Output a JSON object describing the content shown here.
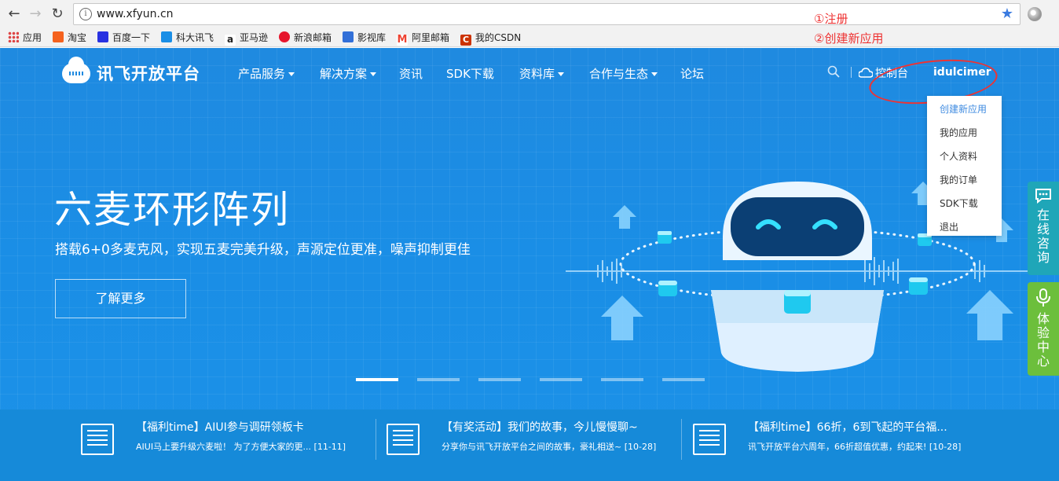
{
  "browser": {
    "url": "www.xfyun.cn",
    "bookmarks": [
      {
        "label": "应用",
        "icon": "apps-grid-icon"
      },
      {
        "label": "淘宝",
        "icon": "taobao-icon",
        "color": "#f5621e"
      },
      {
        "label": "百度一下",
        "icon": "baidu-icon",
        "color": "#2932e1"
      },
      {
        "label": "科大讯飞",
        "icon": "iflytek-icon",
        "color": "#1a8ee6"
      },
      {
        "label": "亚马逊",
        "icon": "amazon-icon",
        "color": "#222222"
      },
      {
        "label": "新浪邮箱",
        "icon": "sina-icon",
        "color": "#e6162d"
      },
      {
        "label": "影视库",
        "icon": "video-icon",
        "color": "#3370d8"
      },
      {
        "label": "阿里邮箱",
        "icon": "ali-mail-icon",
        "color": "#e43"
      },
      {
        "label": "我的CSDN",
        "icon": "csdn-icon",
        "color": "#c30"
      }
    ]
  },
  "annotations": {
    "step1": "①注册",
    "step2": "②创建新应用",
    "color": "#e33"
  },
  "site": {
    "logo_text": "讯飞开放平台",
    "nav": [
      {
        "label": "产品服务",
        "dropdown": true
      },
      {
        "label": "解决方案",
        "dropdown": true
      },
      {
        "label": "资讯",
        "dropdown": false
      },
      {
        "label": "SDK下载",
        "dropdown": false
      },
      {
        "label": "资料库",
        "dropdown": true
      },
      {
        "label": "合作与生态",
        "dropdown": true
      },
      {
        "label": "论坛",
        "dropdown": false
      }
    ],
    "console_label": "控制台",
    "username": "idulcimer",
    "user_menu": [
      "创建新应用",
      "我的应用",
      "个人资料",
      "我的订单",
      "SDK下载",
      "退出"
    ],
    "hero": {
      "title": "六麦环形阵列",
      "subtitle": "搭载6+0多麦克风，实现五麦完美升级，声源定位更准，噪声抑制更佳",
      "button": "了解更多"
    },
    "slider": {
      "count": 6,
      "active": 0
    },
    "side_tabs": [
      {
        "label": "在线咨询",
        "icon": "chat-icon",
        "color": "#1fa6b8"
      },
      {
        "label": "体验中心",
        "icon": "microphone-icon",
        "color": "#6cbf3c"
      }
    ],
    "news": [
      {
        "title": "【福利time】AIUI参与调研领板卡",
        "summary": "AIUI马上要升级六麦啦！ 为了方便大家的更... [11-11]"
      },
      {
        "title": "【有奖活动】我们的故事，今儿慢慢聊~",
        "summary": "分享你与讯飞开放平台之间的故事，豪礼相送~ [10-28]"
      },
      {
        "title": "【福利time】66折，6到飞起的平台福...",
        "summary": "讯飞开放平台六周年，66折超值优惠，约起来! [10-28]"
      }
    ],
    "colors": {
      "brand_blue": "#1f8ae0",
      "menu_active": "#3f8be0"
    }
  }
}
